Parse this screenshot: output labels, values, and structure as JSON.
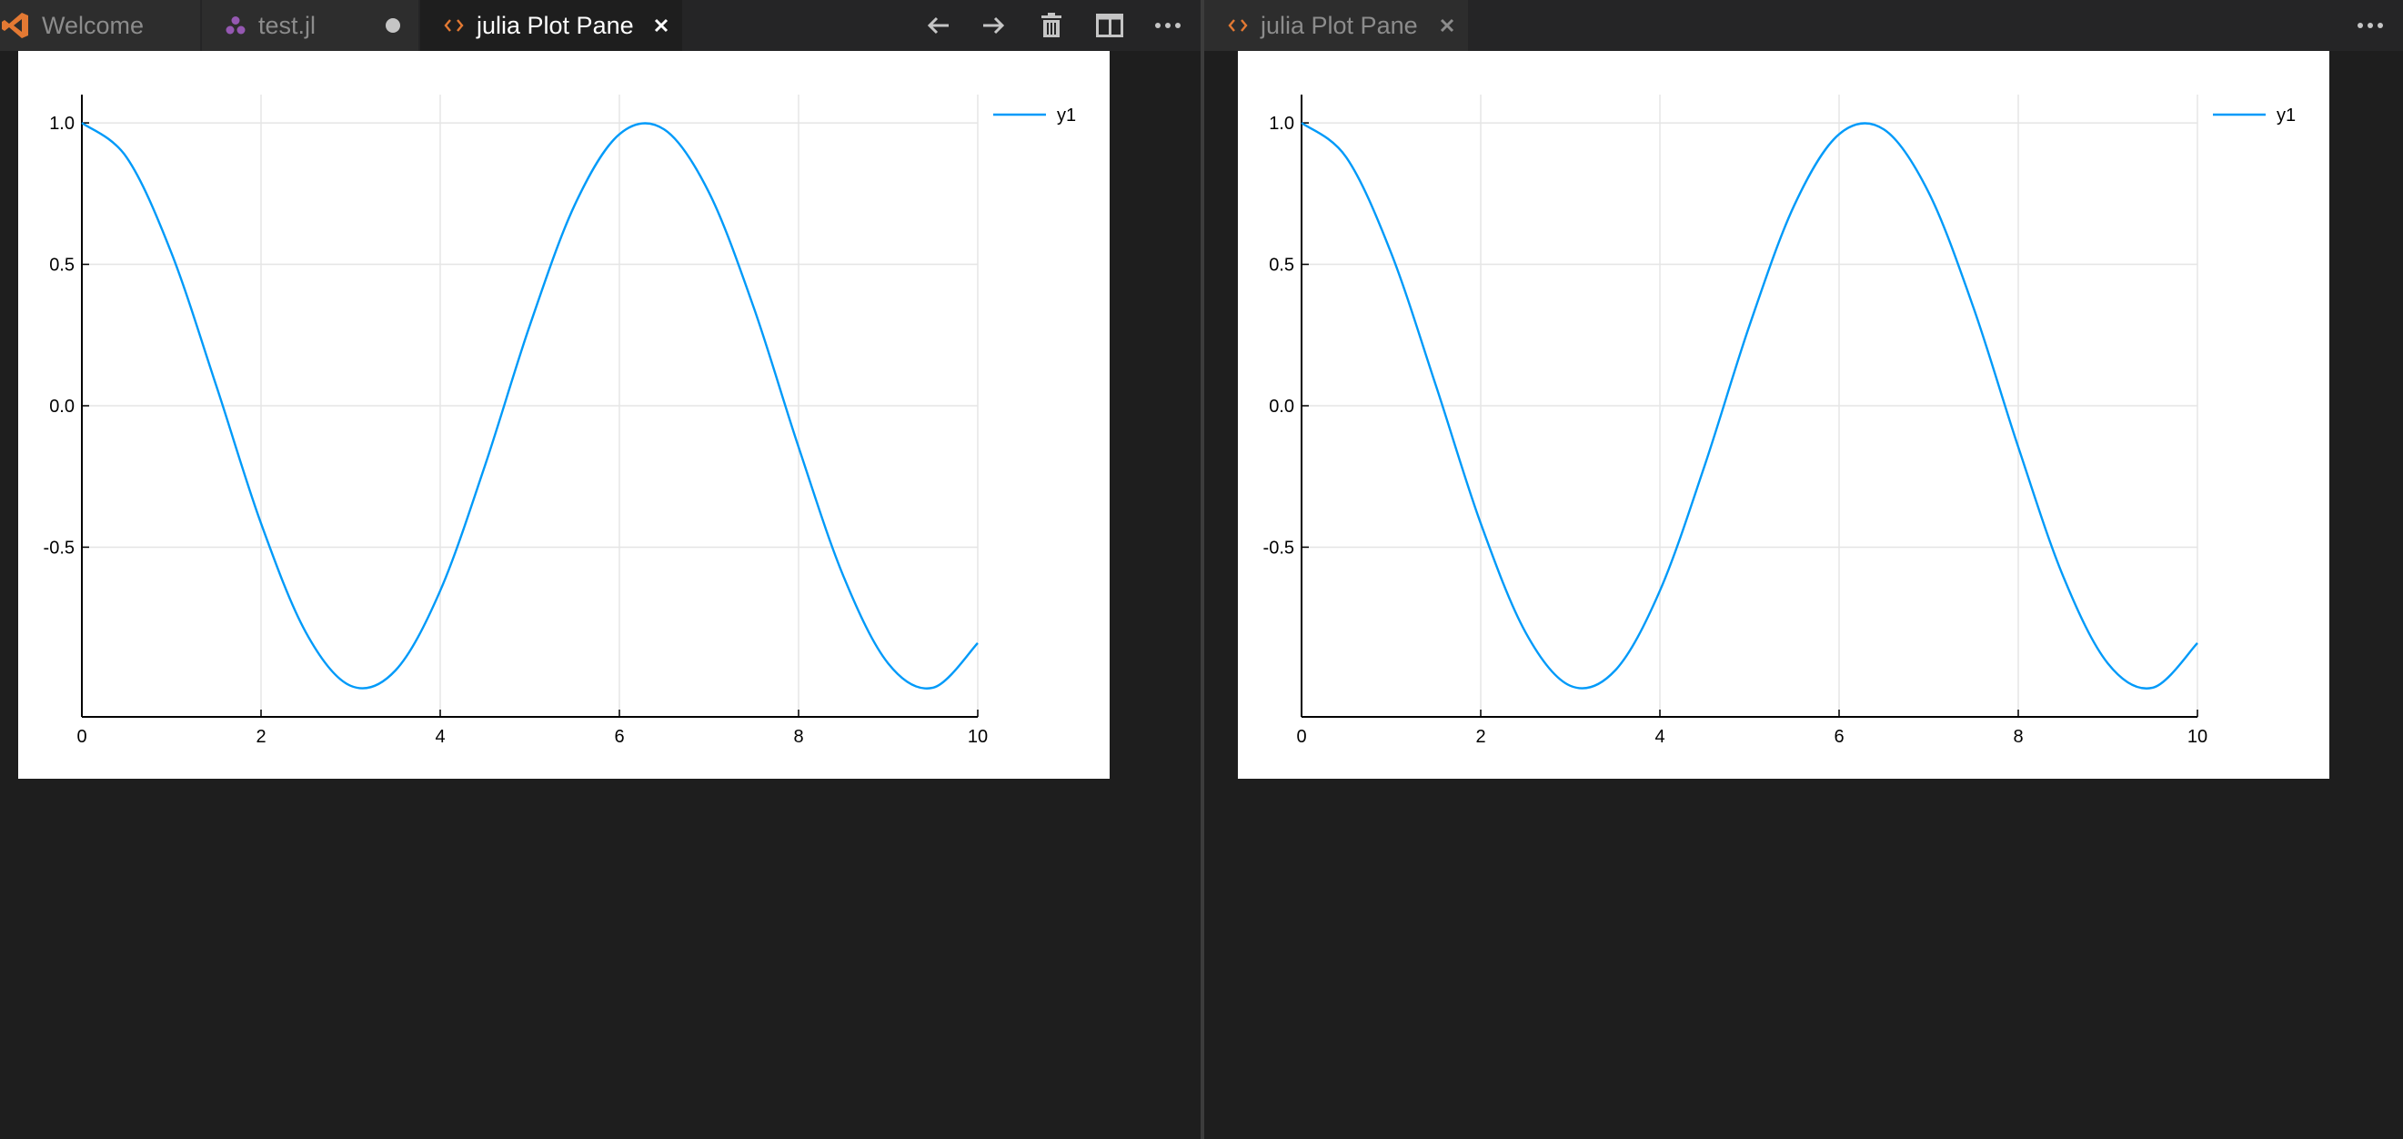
{
  "theme": {
    "background": "#1e1e1e",
    "tab_bar": "#252526",
    "tab_inactive": "#2d2d2d",
    "plot_line": "#009af9",
    "plot_grid": "#e5e5e5",
    "julia_purple": "#9558b2",
    "vscode_orange": "#e37933"
  },
  "left_group": {
    "tabs": [
      {
        "label": "Welcome",
        "icon": "vscode-logo-icon",
        "active": false
      },
      {
        "label": "test.jl",
        "icon": "julia-logo-icon",
        "active": false,
        "unsaved": true
      },
      {
        "label": "julia Plot Pane",
        "icon": "code-brackets-icon",
        "active": true
      }
    ],
    "actions": [
      "arrow-left-icon",
      "arrow-right-icon",
      "trash-icon",
      "split-editor-icon",
      "more-actions-icon"
    ]
  },
  "right_group": {
    "tabs": [
      {
        "label": "julia Plot Pane",
        "icon": "code-brackets-icon",
        "active": false
      }
    ],
    "actions": [
      "more-actions-icon"
    ]
  },
  "chart_data": [
    {
      "type": "line",
      "title": "",
      "xlabel": "",
      "ylabel": "",
      "xlim": [
        0,
        10
      ],
      "ylim": [
        -1.1,
        1.1
      ],
      "xticks": [
        0,
        2,
        4,
        6,
        8,
        10
      ],
      "xtick_labels": [
        "0",
        "2",
        "4",
        "6",
        "8",
        "10"
      ],
      "yticks": [
        1.0,
        0.5,
        0.0,
        -0.5
      ],
      "ytick_labels": [
        "1.0",
        "0.5",
        "0.0",
        "-0.5"
      ],
      "grid": true,
      "legend": "top-right",
      "series": [
        {
          "name": "y1",
          "color": "#009af9",
          "x": [
            0,
            0.5,
            1,
            1.5,
            2,
            2.5,
            3,
            3.5,
            4,
            4.5,
            5,
            5.5,
            6,
            6.5,
            7,
            7.5,
            8,
            8.5,
            9,
            9.5,
            10
          ],
          "y": [
            1.0,
            0.878,
            0.54,
            0.071,
            -0.416,
            -0.801,
            -0.99,
            -0.936,
            -0.654,
            -0.211,
            0.284,
            0.709,
            0.96,
            0.977,
            0.754,
            0.347,
            -0.146,
            -0.602,
            -0.911,
            -0.997,
            -0.839
          ]
        }
      ]
    },
    {
      "type": "line",
      "title": "",
      "xlabel": "",
      "ylabel": "",
      "xlim": [
        0,
        10
      ],
      "ylim": [
        -1.1,
        1.1
      ],
      "xticks": [
        0,
        2,
        4,
        6,
        8,
        10
      ],
      "xtick_labels": [
        "0",
        "2",
        "4",
        "6",
        "8",
        "10"
      ],
      "yticks": [
        1.0,
        0.5,
        0.0,
        -0.5
      ],
      "ytick_labels": [
        "1.0",
        "0.5",
        "0.0",
        "-0.5"
      ],
      "grid": true,
      "legend": "top-right",
      "series": [
        {
          "name": "y1",
          "color": "#009af9",
          "x": [
            0,
            0.5,
            1,
            1.5,
            2,
            2.5,
            3,
            3.5,
            4,
            4.5,
            5,
            5.5,
            6,
            6.5,
            7,
            7.5,
            8,
            8.5,
            9,
            9.5,
            10
          ],
          "y": [
            1.0,
            0.878,
            0.54,
            0.071,
            -0.416,
            -0.801,
            -0.99,
            -0.936,
            -0.654,
            -0.211,
            0.284,
            0.709,
            0.96,
            0.977,
            0.754,
            0.347,
            -0.146,
            -0.602,
            -0.911,
            -0.997,
            -0.839
          ]
        }
      ]
    }
  ]
}
